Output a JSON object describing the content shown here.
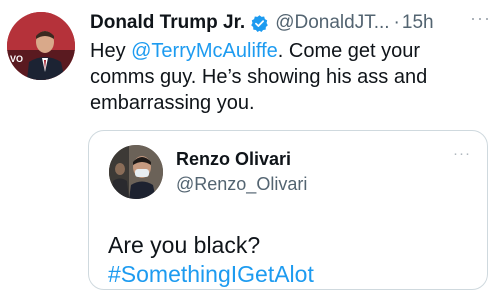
{
  "tweet": {
    "author": {
      "name": "Donald Trump Jr.",
      "handle": "@DonaldJT...",
      "separator": "·",
      "time": "15h",
      "avatar_icon": "profile-photo",
      "verified_icon": "verified-badge-icon"
    },
    "more_label": "···",
    "text_intro": "Hey ",
    "mention": "@TerryMcAuliffe",
    "text_rest": ". Come get your comms guy. He’s showing his ass and embarrassing you.",
    "quote": {
      "name": "Renzo Olivari",
      "handle": "@Renzo_Olivari",
      "more_label": "···",
      "text": "Are you black?",
      "hashtag": "#SomethingIGetAlot"
    }
  },
  "colors": {
    "link": "#1d9bf0",
    "secondary_text": "#536471",
    "primary_text": "#0f1419",
    "border": "#cfd9de"
  }
}
